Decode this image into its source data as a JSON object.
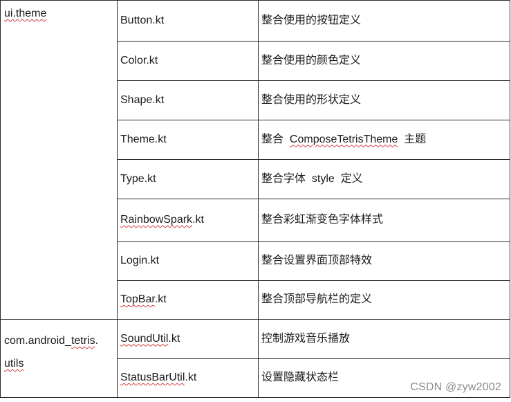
{
  "groups": [
    {
      "package": "ui.theme",
      "rows": [
        {
          "file": "Button.kt",
          "desc": "整合使用的按钮定义"
        },
        {
          "file": "Color.kt",
          "desc": "整合使用的颜色定义"
        },
        {
          "file": "Shape.kt",
          "desc": "整合使用的形状定义"
        },
        {
          "file": "Theme.kt",
          "desc_pre": "整合  ",
          "desc_word": "ComposeTetrisTheme",
          "desc_post": "  主题"
        },
        {
          "file": "Type.kt",
          "desc": "整合字体  style  定义"
        },
        {
          "file_word": "RainbowSpark",
          "file_post": ".kt",
          "desc": "整合彩虹渐变色字体样式"
        },
        {
          "file": "Login.kt",
          "desc": "整合设置界面顶部特效"
        },
        {
          "file_word": "TopBar",
          "file_post": ".kt",
          "desc": "整合顶部导航栏的定义"
        }
      ]
    },
    {
      "package_line1_pre": "com.android_",
      "package_line1_word": "tetris",
      "package_line1_post": ".",
      "package_line2_word": "utils",
      "rows": [
        {
          "file_word": "SoundUtil",
          "file_post": ".kt",
          "desc": "控制游戏音乐播放"
        },
        {
          "file_word": "StatusBarUtil",
          "file_post": ".kt",
          "desc": "设置隐藏状态栏"
        }
      ]
    }
  ],
  "watermark": "CSDN @zyw2002",
  "colors": {
    "spellcheck_underline": "#d23a3a",
    "border": "#2b2b2b",
    "watermark": "#8a8a8a"
  }
}
